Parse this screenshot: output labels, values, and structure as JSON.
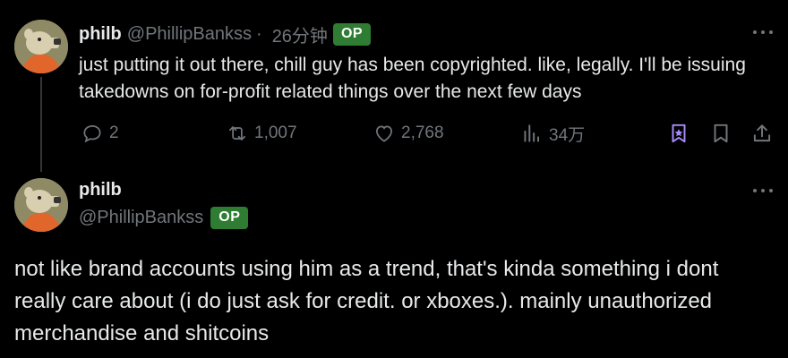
{
  "post1": {
    "author_name": "philb",
    "handle": "@PhillipBankss",
    "separator": "·",
    "time": "26分钟",
    "badge": "OP",
    "text": "just putting it out there, chill guy has been copyrighted. like, legally. I'll be issuing takedowns on for-profit related things over the next few days",
    "actions": {
      "reply_count": "2",
      "repost_count": "1,007",
      "like_count": "2,768",
      "views_count": "34万"
    }
  },
  "post2": {
    "author_name": "philb",
    "handle": "@PhillipBankss",
    "badge": "OP",
    "text": "not like brand accounts using him as a trend, that's kinda something i dont really care about (i do just ask for credit. or xboxes.). mainly unauthorized merchandise and shitcoins"
  },
  "colors": {
    "background": "#000000",
    "text": "#e7e9ea",
    "muted": "#71767b",
    "op_badge": "#2e7d32",
    "grok_icon": "#a78bfa"
  },
  "icons": [
    "reply-icon",
    "repost-icon",
    "like-icon",
    "views-icon",
    "grok-icon",
    "bookmark-icon",
    "share-icon",
    "more-icon"
  ]
}
